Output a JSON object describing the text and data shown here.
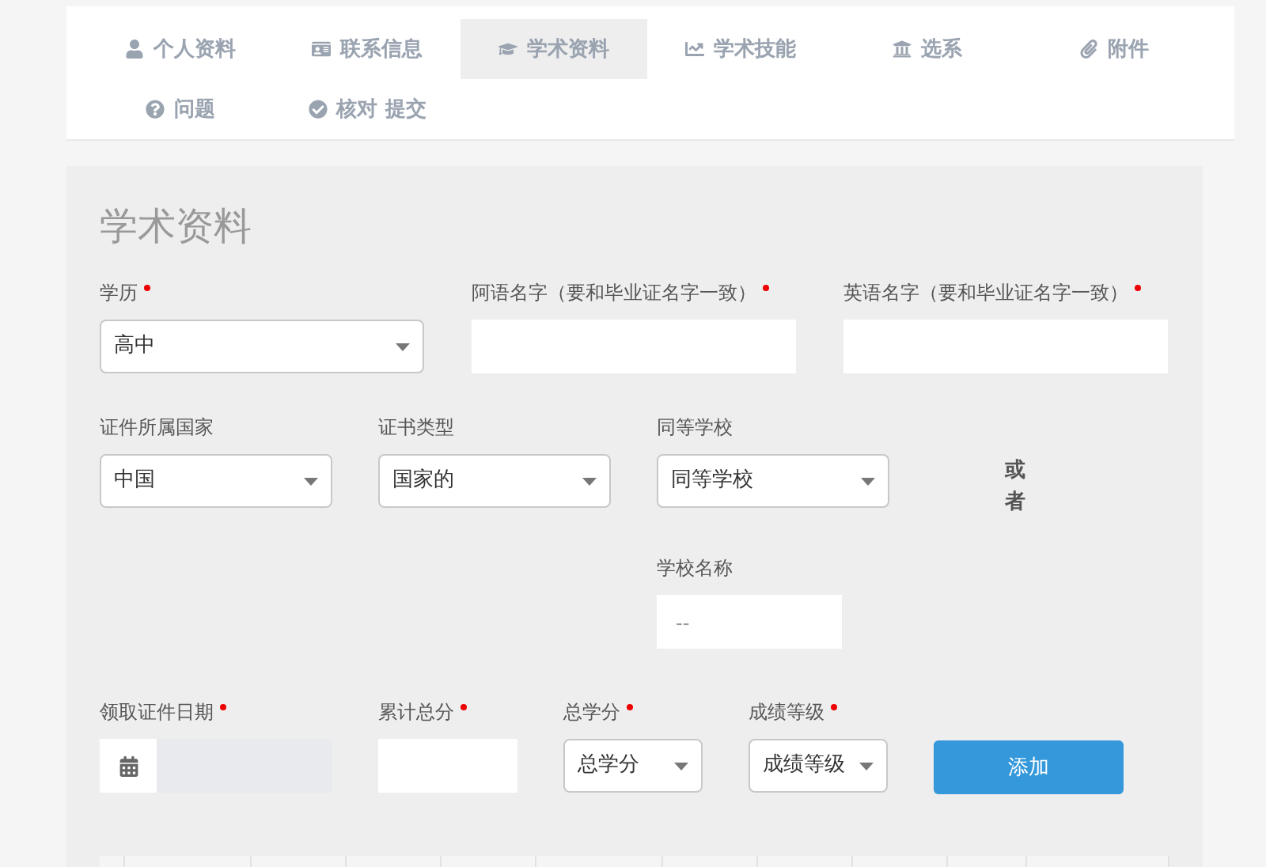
{
  "tabs": [
    {
      "label": "个人资料",
      "selected": false
    },
    {
      "label": "联系信息",
      "selected": false
    },
    {
      "label": "学术资料",
      "selected": true
    },
    {
      "label": "学术技能",
      "selected": false
    },
    {
      "label": "选系",
      "selected": false
    },
    {
      "label": "附件",
      "selected": false
    },
    {
      "label": "问题",
      "selected": false
    },
    {
      "label": "核对 提交",
      "selected": false
    }
  ],
  "section": {
    "title": "学术资料",
    "row_1": [
      {
        "kind": "select",
        "label": "学历",
        "required": true,
        "value": "高中"
      },
      {
        "kind": "text",
        "label": "阿语名字（要和毕业证名字一致）",
        "required": true
      },
      {
        "kind": "text",
        "label": "英语名字（要和毕业证名字一致）",
        "required": true
      }
    ],
    "row_2": [
      {
        "kind": "select",
        "label": "证件所属国家",
        "required": false,
        "value": "中国"
      },
      {
        "kind": "select",
        "label": "证书类型",
        "required": false,
        "value": "国家的"
      },
      {
        "kind": "select",
        "label": "同等学校",
        "required": false,
        "value": "同等学校"
      }
    ],
    "or_text": "或者",
    "school_name": {
      "label": "学校名称",
      "placeholder": "--"
    },
    "row_3": [
      {
        "kind": "date",
        "label": "领取证件日期",
        "required": true
      },
      {
        "kind": "text",
        "label": "累计总分",
        "required": true
      },
      {
        "kind": "select",
        "label": "总学分",
        "required": true,
        "value": "总学分"
      },
      {
        "kind": "select",
        "label": "成绩等级",
        "required": true,
        "value": "成绩等级"
      }
    ],
    "add_button": "添加"
  }
}
